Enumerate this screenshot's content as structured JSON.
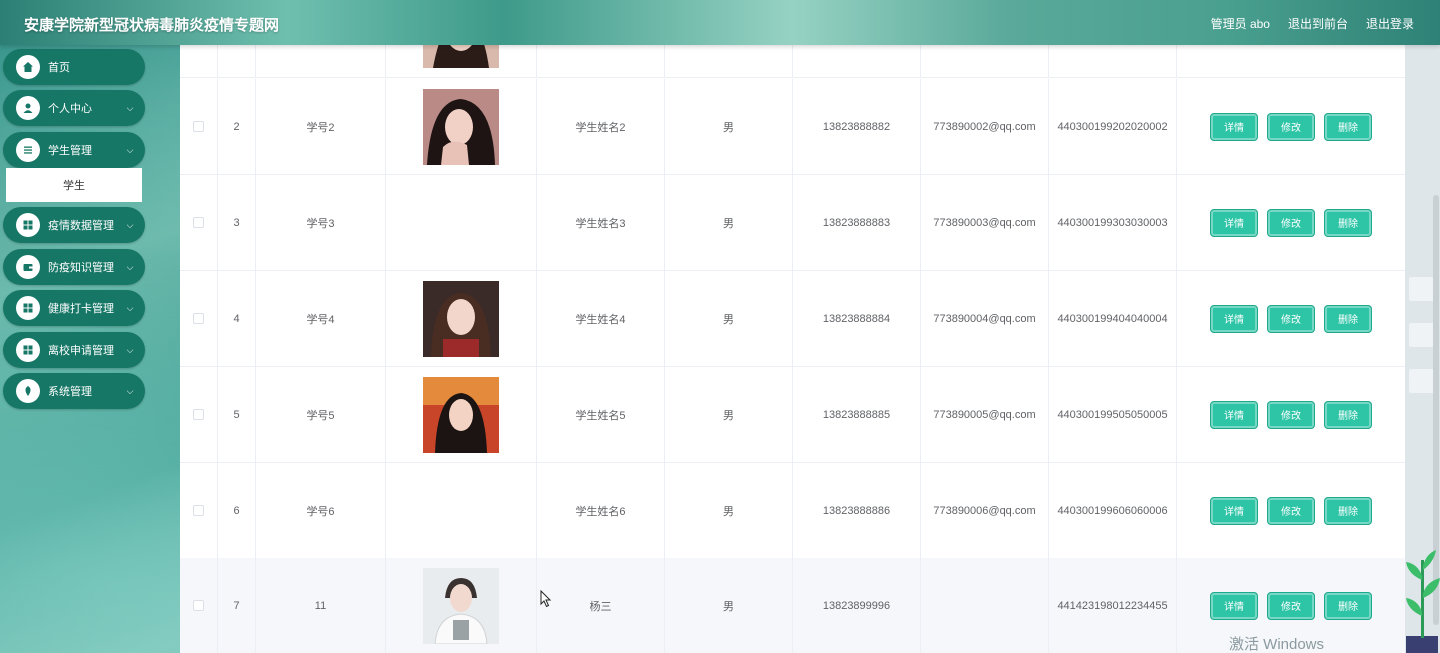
{
  "header": {
    "title": "安康学院新型冠状病毒肺炎疫情专题网",
    "user": "管理员 abo",
    "front_link": "退出到前台",
    "logout": "退出登录"
  },
  "sidebar": {
    "items": [
      {
        "label": "首页",
        "icon": "home-icon"
      },
      {
        "label": "个人中心",
        "icon": "user-icon"
      },
      {
        "label": "学生管理",
        "icon": "list-icon"
      },
      {
        "label": "疫情数据管理",
        "icon": "grid-icon"
      },
      {
        "label": "防疫知识管理",
        "icon": "wallet-icon"
      },
      {
        "label": "健康打卡管理",
        "icon": "grid-icon"
      },
      {
        "label": "离校申请管理",
        "icon": "grid-icon"
      },
      {
        "label": "系统管理",
        "icon": "leaf-icon"
      }
    ],
    "sub_item": "学生"
  },
  "table": {
    "ops": {
      "detail": "详情",
      "edit": "修改",
      "delete": "删除"
    },
    "rows": [
      {
        "idx": "2",
        "number": "学号2",
        "name": "学生姓名2",
        "sex": "男",
        "phone": "13823888882",
        "email": "773890002@qq.com",
        "id_card": "440300199202020002"
      },
      {
        "idx": "3",
        "number": "学号3",
        "name": "学生姓名3",
        "sex": "男",
        "phone": "13823888883",
        "email": "773890003@qq.com",
        "id_card": "440300199303030003"
      },
      {
        "idx": "4",
        "number": "学号4",
        "name": "学生姓名4",
        "sex": "男",
        "phone": "13823888884",
        "email": "773890004@qq.com",
        "id_card": "440300199404040004"
      },
      {
        "idx": "5",
        "number": "学号5",
        "name": "学生姓名5",
        "sex": "男",
        "phone": "13823888885",
        "email": "773890005@qq.com",
        "id_card": "440300199505050005"
      },
      {
        "idx": "6",
        "number": "学号6",
        "name": "学生姓名6",
        "sex": "男",
        "phone": "13823888886",
        "email": "773890006@qq.com",
        "id_card": "440300199606060006"
      },
      {
        "idx": "7",
        "number": "11",
        "name": "杨三",
        "sex": "男",
        "phone": "13823899996",
        "email": "",
        "id_card": "441423198012234455"
      }
    ]
  },
  "watermark": "激活 Windows",
  "colors": {
    "sidebar": "#167766",
    "button": "#2ec4a6",
    "header": "#3e9a8a"
  }
}
